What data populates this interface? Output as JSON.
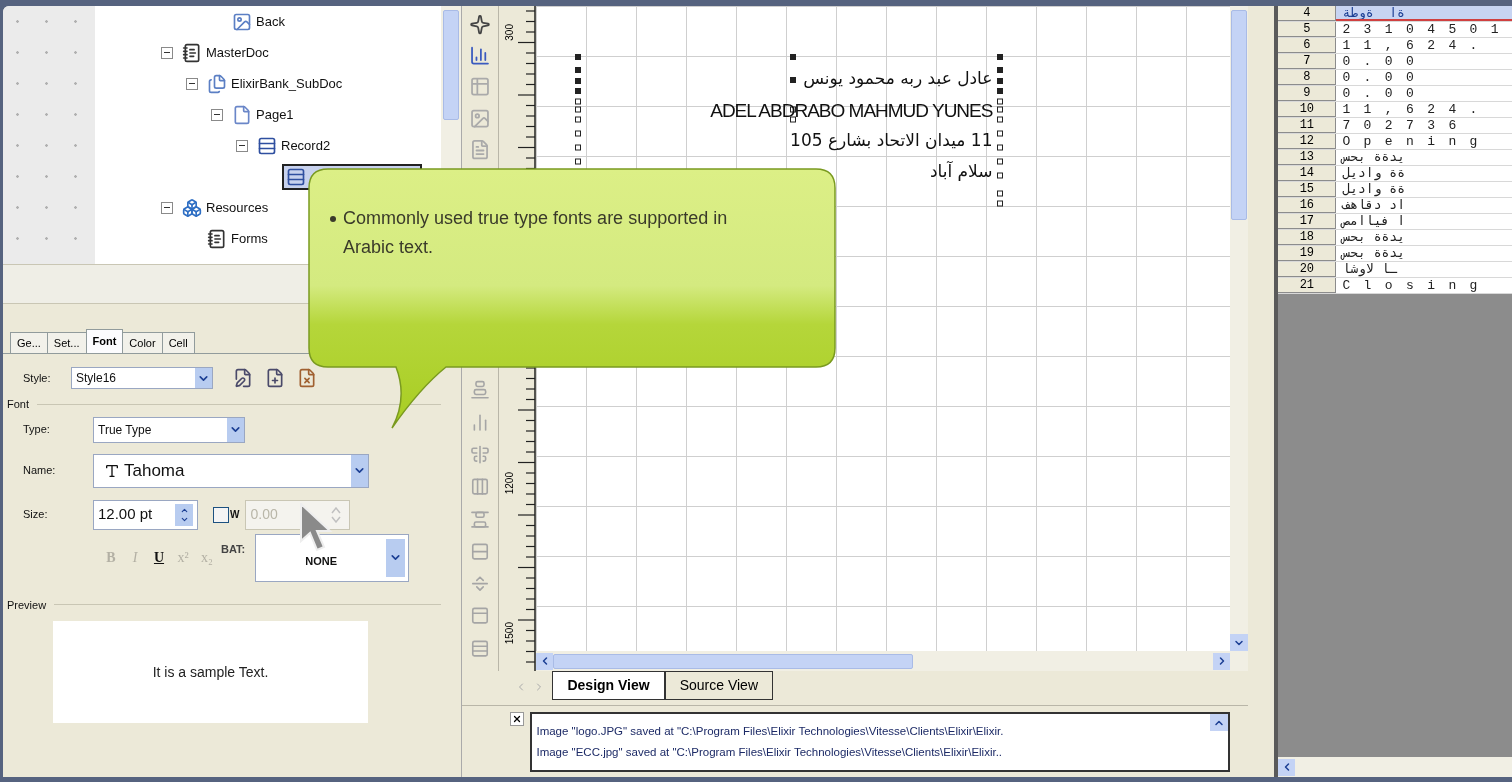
{
  "tree": {
    "continued_children": [
      {
        "label": "Back",
        "kind": "image",
        "selected": false
      }
    ],
    "items": [
      {
        "label": "MasterDoc",
        "kind": "notebook",
        "selected": false,
        "expanded": true,
        "children": [
          {
            "label": "ElixirBank_SubDoc",
            "kind": "document",
            "selected": false,
            "expanded": true,
            "children": [
              {
                "label": "Page1",
                "kind": "page",
                "selected": false,
                "expanded": true,
                "children": [
                  {
                    "label": "Record2",
                    "kind": "record",
                    "selected": false,
                    "expanded": true,
                    "children": [
                      {
                        "kind": "record",
                        "selected": true
                      }
                    ]
                  }
                ]
              }
            ]
          }
        ]
      },
      {
        "label": "Resources",
        "kind": "resources",
        "selected": false,
        "expanded": true,
        "children": [
          {
            "label": "Forms",
            "kind": "notebook",
            "selected": false
          }
        ]
      }
    ]
  },
  "tabs": [
    {
      "label": "Ge...",
      "selected": false
    },
    {
      "label": "Set...",
      "selected": false
    },
    {
      "label": "Font",
      "selected": true
    },
    {
      "label": "Color",
      "selected": false
    },
    {
      "label": "Cell",
      "selected": false
    }
  ],
  "font_panel": {
    "style": {
      "label": "Style:",
      "value": "Style16"
    },
    "group": "Font",
    "type": {
      "label": "Type:",
      "value": "True Type"
    },
    "name": {
      "label": "Name:",
      "value": "Tahoma"
    },
    "size": {
      "label": "Size:",
      "value": "12.00 pt"
    },
    "width": {
      "label": "W",
      "checked": false,
      "value": "0.00",
      "disabled": true
    },
    "format_buttons": [
      {
        "label": "B",
        "kind": "bold",
        "disabled": true
      },
      {
        "label": "I",
        "kind": "italic",
        "disabled": true
      },
      {
        "label": "U",
        "kind": "underline",
        "disabled": false
      },
      {
        "label": "x²",
        "kind": "superscript",
        "disabled": true
      },
      {
        "label": "x₂",
        "kind": "subscript",
        "disabled": true
      }
    ],
    "bat": {
      "label": "BAT:",
      "value": "NONE"
    },
    "preview": {
      "label": "Preview",
      "text": "It is a sample Text."
    }
  },
  "canvas": {
    "ruler_labels": [
      {
        "text": "300",
        "kind": "top"
      },
      {
        "text": "1200",
        "kind": "middle"
      },
      {
        "text": "1500",
        "kind": "bottom"
      }
    ],
    "text_lines": [
      {
        "text": "عادل عبد ربه محمود يونس",
        "kind": "arabic"
      },
      {
        "text": "ADEL ABDRABO MAHMUD YUNES",
        "kind": "latin"
      },
      {
        "text": "11 ميدان الاتحاد بشارع 105",
        "kind": "arabic"
      },
      {
        "text": "سلام آباد",
        "kind": "arabic"
      }
    ]
  },
  "view_tabs": [
    {
      "label": "Design View",
      "selected": true
    },
    {
      "label": "Source View",
      "selected": false
    }
  ],
  "log": [
    "Image \"logo.JPG\" saved at \"C:\\Program Files\\Elixir Technologies\\Vitesse\\Clients\\Elixir\\Elixir.",
    "Image \"ECC.jpg\" saved at \"C:\\Program Files\\Elixir Technologies\\Vitesse\\Clients\\Elixir\\Elixir.."
  ],
  "spreadsheet": {
    "rows": [
      {
        "number": "4",
        "text": "ةطوة  اة",
        "selected": true
      },
      {
        "number": "5",
        "text": "23104501",
        "selected": false
      },
      {
        "number": "6",
        "text": "11,624.",
        "selected": false
      },
      {
        "number": "7",
        "text": "0.00",
        "selected": false
      },
      {
        "number": "8",
        "text": "0.00",
        "selected": false
      },
      {
        "number": "9",
        "text": "0.00",
        "selected": false
      },
      {
        "number": "10",
        "text": "11,624.",
        "selected": false
      },
      {
        "number": "11",
        "text": "702736",
        "selected": false
      },
      {
        "number": "12",
        "text": "Opening",
        "selected": false
      },
      {
        "number": "13",
        "text": "سحب ةةدي",
        "selected": false
      },
      {
        "number": "14",
        "text": "ليداو ةة",
        "selected": false
      },
      {
        "number": "15",
        "text": "ليداو ةة",
        "selected": false
      },
      {
        "number": "16",
        "text": "فهاقد دا",
        "selected": false
      },
      {
        "number": "17",
        "text": "صماايف ا",
        "selected": false
      },
      {
        "number": "18",
        "text": "سحب ةةدي",
        "selected": false
      },
      {
        "number": "19",
        "text": "سحب ةةدي",
        "selected": false
      },
      {
        "number": "20",
        "text": "اشوال اـ",
        "selected": false
      },
      {
        "number": "21",
        "text": "Closing",
        "selected": false
      }
    ]
  },
  "callout": {
    "text": "Commonly used true type fonts are supported in Arabic text."
  }
}
